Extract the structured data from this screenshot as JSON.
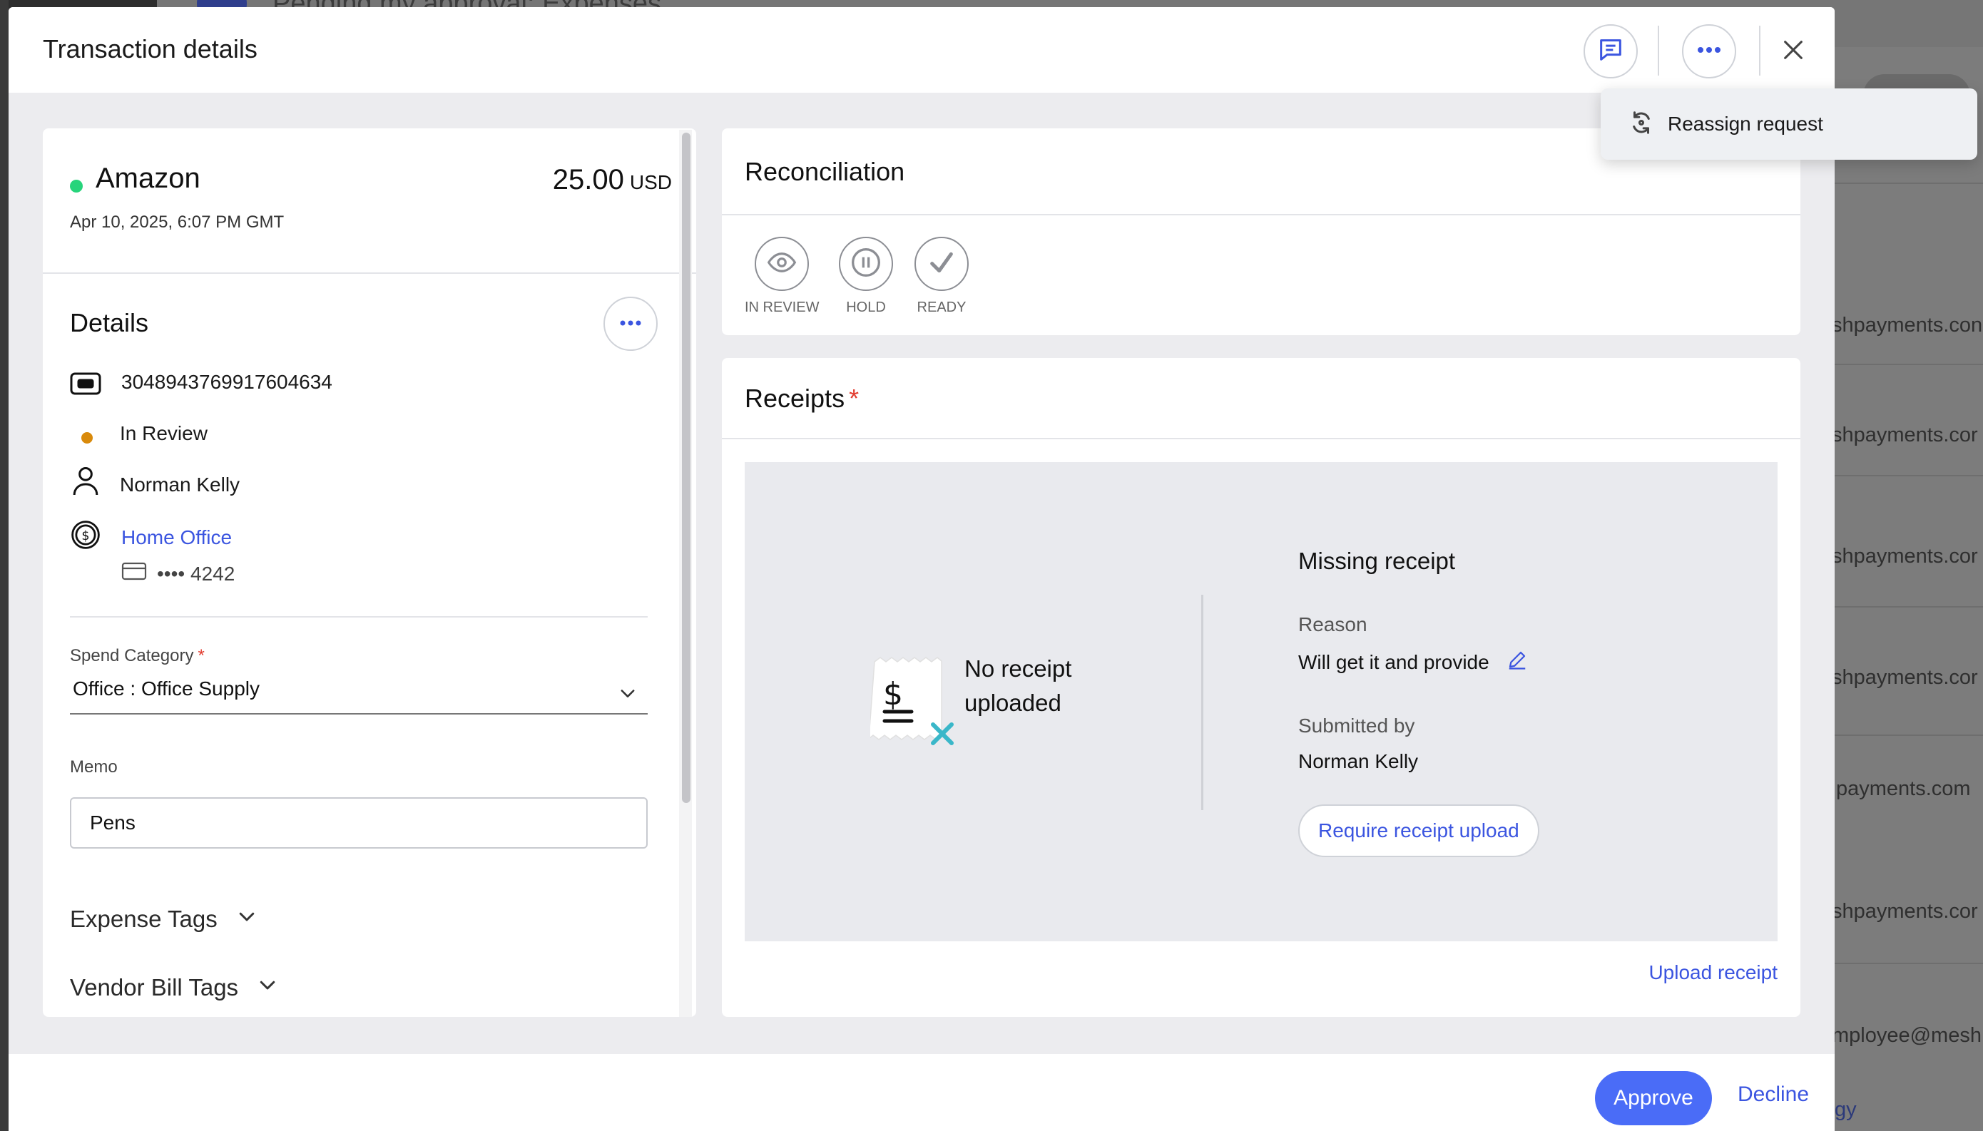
{
  "background": {
    "page_title": "Pending my approval: Expenses",
    "emails": [
      "shpayments.con",
      "shpayments.cor",
      "shpayments.cor",
      "shpayments.cor",
      "payments.com",
      "shpayments.cor",
      "mployee@mesh"
    ],
    "footer_link": "gy"
  },
  "modal": {
    "title": "Transaction details",
    "header_icons": [
      "comment-icon",
      "more-icon",
      "close-icon"
    ]
  },
  "menu": {
    "items": [
      {
        "label": "Reassign request",
        "icon": "reassign-icon"
      }
    ]
  },
  "transaction": {
    "merchant": "Amazon",
    "amount": "25.00",
    "currency": "USD",
    "date": "Apr 10, 2025, 6:07 PM GMT",
    "status_color": "#27d47b"
  },
  "details": {
    "title": "Details",
    "transaction_id": "3048943769917604634",
    "status": "In Review",
    "status_color": "#d98a0b",
    "employee": "Norman Kelly",
    "budget": "Home Office",
    "card_mask": "•••• 4242",
    "spend_category_label": "Spend Category",
    "spend_category_value": "Office : Office Supply",
    "memo_label": "Memo",
    "memo_value": "Pens",
    "expense_tags_label": "Expense Tags",
    "vendor_bill_tags_label": "Vendor Bill Tags"
  },
  "reconciliation": {
    "title": "Reconciliation",
    "steps": [
      {
        "label": "IN REVIEW",
        "icon": "eye-icon"
      },
      {
        "label": "HOLD",
        "icon": "pause-icon"
      },
      {
        "label": "READY",
        "icon": "check-icon"
      }
    ]
  },
  "receipts": {
    "title": "Receipts",
    "required_mark": "*",
    "no_receipt_line1": "No receipt",
    "no_receipt_line2": "uploaded",
    "missing_title": "Missing receipt",
    "reason_label": "Reason",
    "reason_value": "Will get it and provide",
    "submitted_by_label": "Submitted by",
    "submitted_by_value": "Norman Kelly",
    "require_button": "Require receipt upload",
    "upload_link": "Upload receipt"
  },
  "footer": {
    "approve": "Approve",
    "decline": "Decline",
    "accent": "#4a6cf7"
  }
}
